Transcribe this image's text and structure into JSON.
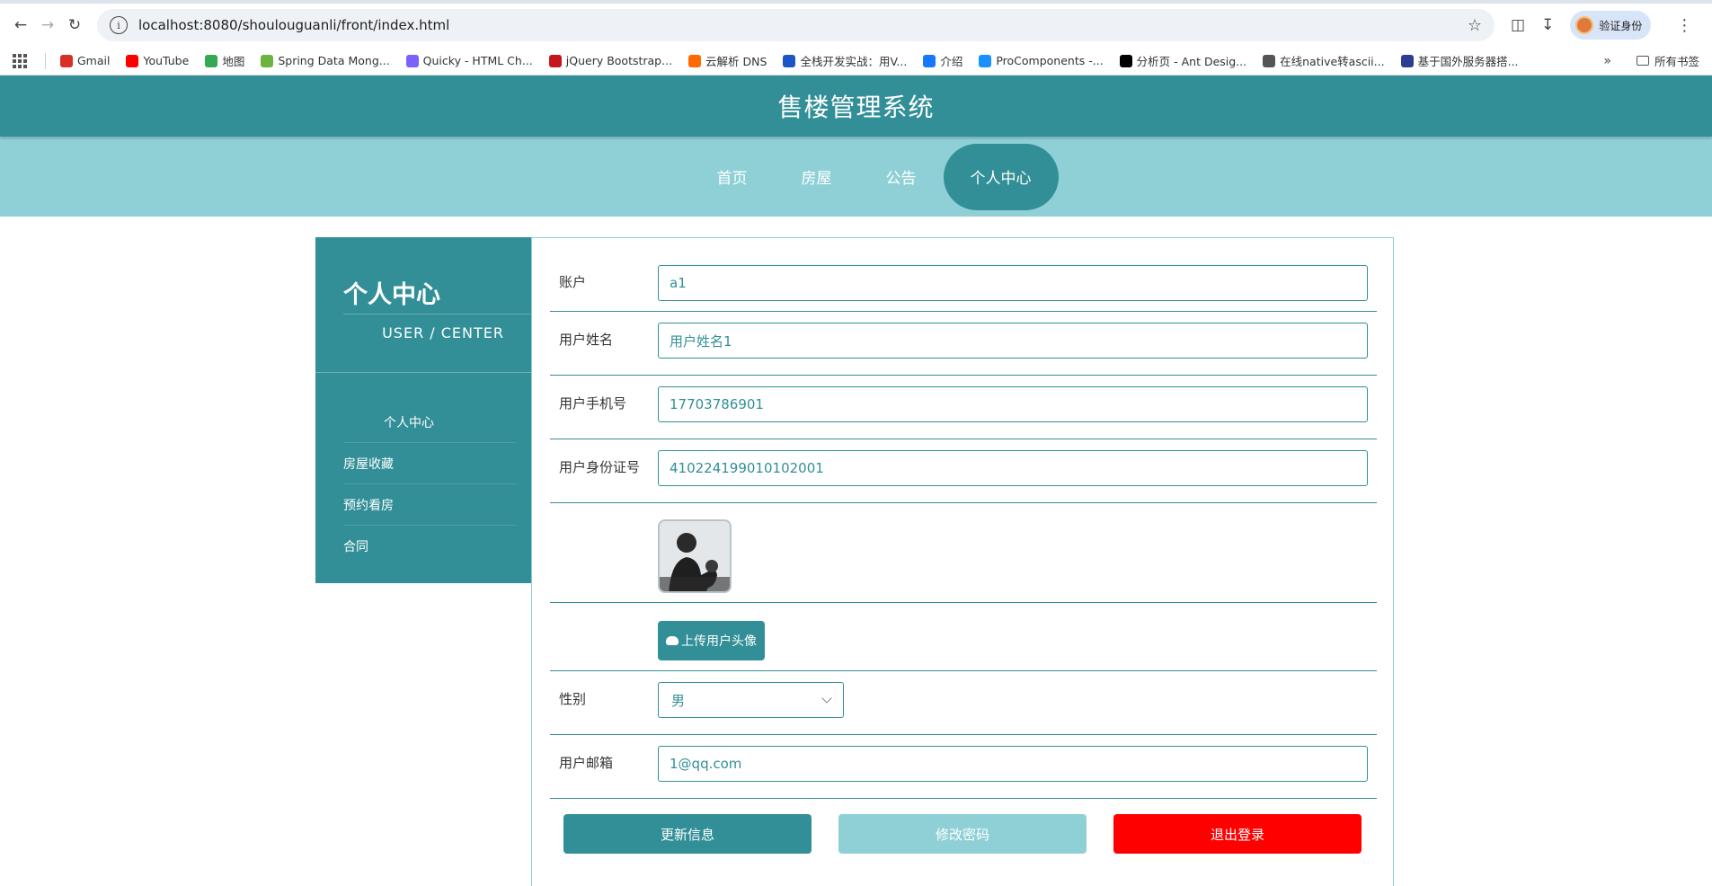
{
  "browser": {
    "url": "localhost:8080/shoulouguanli/front/index.html",
    "profile_label": "验证身份",
    "bookmarks": [
      {
        "label": "Gmail",
        "color": "#d93025"
      },
      {
        "label": "YouTube",
        "color": "#ff0000"
      },
      {
        "label": "地图",
        "color": "#34a853"
      },
      {
        "label": "Spring Data Mong...",
        "color": "#6db33f"
      },
      {
        "label": "Quicky - HTML Ch...",
        "color": "#7b61ff"
      },
      {
        "label": "jQuery Bootstrap...",
        "color": "#c4161c"
      },
      {
        "label": "云解析 DNS",
        "color": "#ff6a00"
      },
      {
        "label": "全栈开发实战：用V...",
        "color": "#1a56c5"
      },
      {
        "label": "介绍",
        "color": "#1677ff"
      },
      {
        "label": "ProComponents -...",
        "color": "#1890ff"
      },
      {
        "label": "分析页 - Ant Desig...",
        "color": "#000000"
      },
      {
        "label": "在线native转ascii...",
        "color": "#555555"
      },
      {
        "label": "基于国外服务器搭...",
        "color": "#2c3e91"
      }
    ],
    "all_bookmarks_label": "所有书签"
  },
  "site": {
    "title": "售楼管理系统",
    "nav": [
      "首页",
      "房屋",
      "公告",
      "个人中心"
    ],
    "active_nav": "个人中心"
  },
  "sidebar": {
    "title": "个人中心",
    "subtitle": "USER / CENTER",
    "items": [
      "个人中心",
      "房屋收藏",
      "预约看房",
      "合同"
    ]
  },
  "form": {
    "account_label": "账户",
    "account_value": "a1",
    "name_label": "用户姓名",
    "name_value": "用户姓名1",
    "phone_label": "用户手机号",
    "phone_value": "17703786901",
    "idcard_label": "用户身份证号",
    "idcard_value": "410224199010102001",
    "upload_label": "上传用户头像",
    "gender_label": "性别",
    "gender_value": "男",
    "email_label": "用户邮箱",
    "email_value": "1@qq.com"
  },
  "actions": {
    "update": "更新信息",
    "change_password": "修改密码",
    "logout": "退出登录"
  },
  "colors": {
    "primary": "#328f97",
    "light": "#8fd0d7",
    "danger": "#ff0000"
  }
}
